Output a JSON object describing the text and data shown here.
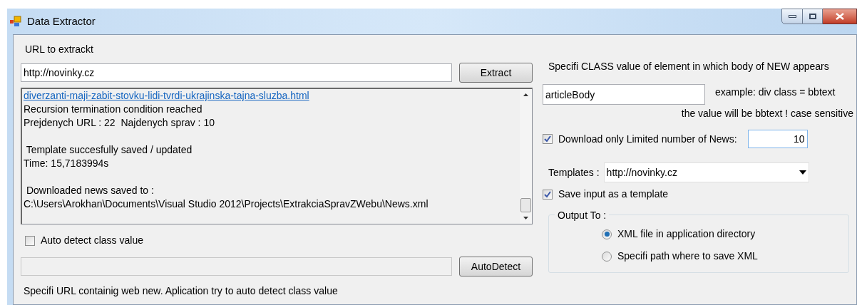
{
  "window": {
    "title": "Data Extractor"
  },
  "url_label": "URL to extrackt",
  "url_field": {
    "value": "http://novinky.cz"
  },
  "extract_button": "Extract",
  "log": [
    {
      "lines": [
        {
          "text": "diverzanti-maji-zabit-stovku-lidi-tvrdi-ukrajinska-tajna-sluzba.html",
          "kind": "link"
        },
        {
          "text": "Recursion termination condition reached",
          "kind": "text"
        },
        {
          "text": "Prejdenych URL : 22  Najdenych sprav : 10",
          "kind": "text"
        }
      ]
    },
    {
      "lines": [
        {
          "text": " Template succesfully saved / updated",
          "kind": "text"
        },
        {
          "text": "Time: 15,7183994s",
          "kind": "text"
        }
      ]
    },
    {
      "lines": [
        {
          "text": " Downloaded news saved to :",
          "kind": "text"
        },
        {
          "text": "C:\\Users\\Arokhan\\Documents\\Visual Studio 2012\\Projects\\ExtrakciaSpravZWebu\\News.xml",
          "kind": "text"
        }
      ]
    }
  ],
  "auto_detect": {
    "label": "Auto detect class value",
    "checked": false
  },
  "auto_detect_button": "AutoDetect",
  "auto_detect_hint": "Specifi URL containig web new. Aplication try to auto detect class value",
  "class_label": "Specifi CLASS value of element in which body of NEW appears",
  "class_field": {
    "value": "articleBody"
  },
  "example": "example: div class = bbtext",
  "example_note": "the value will be bbtext ! case sensitive",
  "limit": {
    "label": "Download only Limited number of News:",
    "checked": true,
    "value": "10"
  },
  "templates": {
    "label": "Templates :",
    "value": "http://novinky.cz"
  },
  "save_template": {
    "label": "Save input as a template",
    "checked": true
  },
  "output": {
    "title": "Output To :",
    "options": [
      {
        "label": "XML file in application directory",
        "selected": true
      },
      {
        "label": "Specifi path where to save XML",
        "selected": false
      }
    ]
  }
}
